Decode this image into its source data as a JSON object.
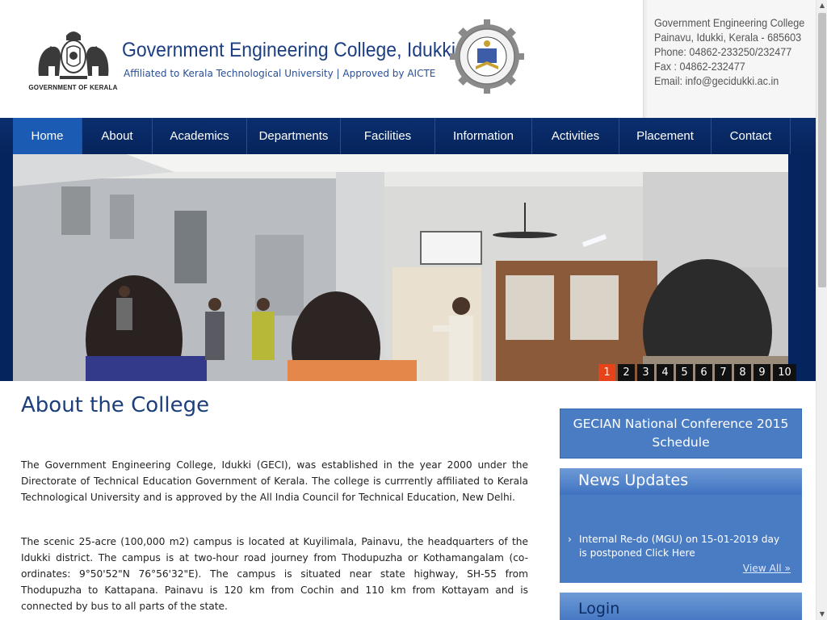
{
  "header": {
    "emblem_caption": "GOVERNMENT OF KERALA",
    "title": "Government Engineering College, Idukki",
    "subtitle": "Affiliated to Kerala Technological University | Approved by AICTE",
    "seal_icon": "college-seal-icon",
    "contact": {
      "line1": "Government Engineering College",
      "line2": "Painavu, Idukki, Kerala - 685603",
      "phone": "Phone: 04862-233250/232477",
      "fax": "Fax : 04862-232477",
      "email": "Email: info@gecidukki.ac.in"
    }
  },
  "nav": {
    "items": [
      {
        "label": "Home",
        "active": true
      },
      {
        "label": "About"
      },
      {
        "label": "Academics"
      },
      {
        "label": "Departments"
      },
      {
        "label": "Facilities"
      },
      {
        "label": "Information"
      },
      {
        "label": "Activities"
      },
      {
        "label": "Placement"
      },
      {
        "label": "Contact"
      }
    ]
  },
  "slider": {
    "active_slide": 1,
    "pager": [
      "1",
      "2",
      "3",
      "4",
      "5",
      "6",
      "7",
      "8",
      "9",
      "10"
    ]
  },
  "about": {
    "title": "About the College",
    "para1": "The Government Engineering College, Idukki (GECI), was established in the year 2000 under the Directorate of Technical Education Government of Kerala. The college is currrently affiliated to Kerala Technological University and is approved by the All India Council for Technical Education, New Delhi.",
    "para2": "The scenic 25-acre (100,000 m2) campus is located at Kuyilimala, Painavu, the headquarters of the Idukki district. The campus is at two-hour road journey from Thodupuzha or Kothamangalam (co-ordinates: 9°50'52\"N 76°56'32\"E). The campus is situated near state highway, SH-55 from Thodupuzha to Kattapana. Painavu is 120 km from Cochin and 110 km from Kottayam and is connected by bus to all parts of the state."
  },
  "sidebar": {
    "conference": "GECIAN National Conference 2015 Schedule",
    "news_title": "News Updates",
    "news_items": [
      "Internal Re-do (MGU) on 15-01-2019 day is postponed Click Here"
    ],
    "view_all": "View All »",
    "login_title": "Login"
  },
  "colors": {
    "nav_bg": "#0a2e6e",
    "nav_active": "#1b5bb3",
    "title_blue": "#1d3f82",
    "sidebar_box": "#4a7cc4",
    "pager_active": "#e6431a"
  }
}
